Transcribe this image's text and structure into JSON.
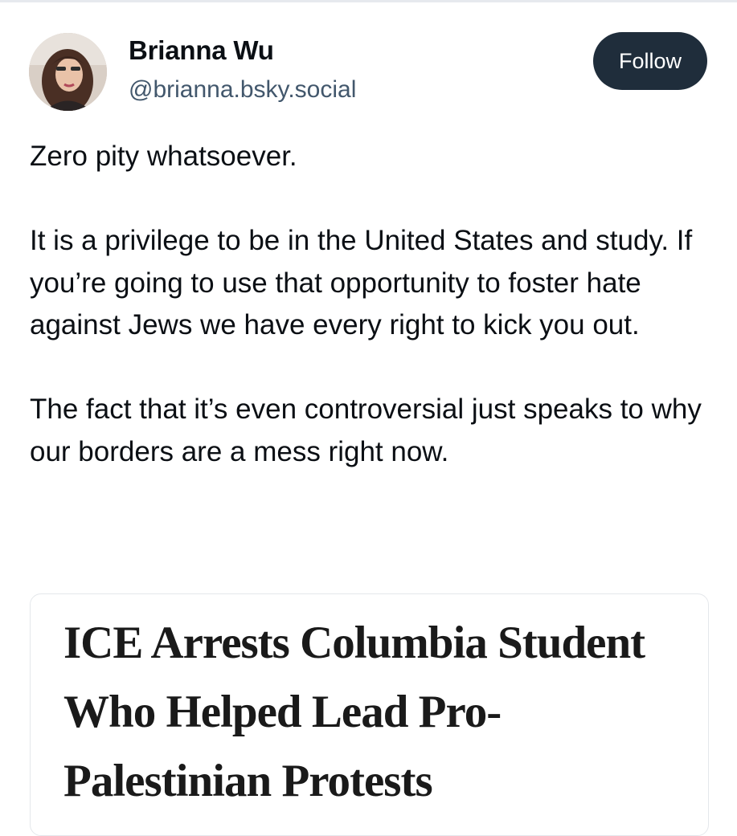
{
  "author": {
    "display_name": "Brianna Wu",
    "handle": "@brianna.bsky.social"
  },
  "actions": {
    "follow_label": "Follow"
  },
  "post": {
    "paragraphs": [
      "Zero pity whatsoever.",
      "It is a privilege to be in the United States and study. If you’re going to use that opportunity to foster hate against Jews we have every right to kick you out.",
      "The fact that it’s even controversial just speaks to why our borders are a mess right now."
    ]
  },
  "embed": {
    "headline": "ICE Arrests Columbia Student Who Helped Lead Pro-Palestinian Protests"
  },
  "colors": {
    "follow_bg": "#1f2d3b",
    "handle_text": "#42576c",
    "body_text": "#0b0f14"
  }
}
